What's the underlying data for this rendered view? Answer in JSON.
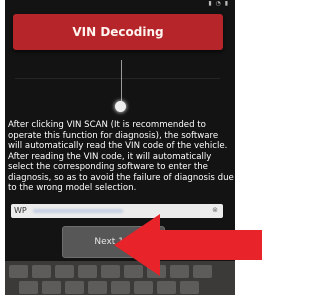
{
  "header": {
    "title": "VIN Decoding"
  },
  "tutorial": {
    "text": "After clicking VIN SCAN (It is recommended to operate this function for diagnosis), the software will automatically read the VIN code of the vehicle. After reading the VIN code, it will automatically select the corresponding software to enter the diagnosis, so as to avoid the failure of diagnosis due to the wrong model selection."
  },
  "vin_input": {
    "value_prefix": "WP"
  },
  "next_button": {
    "label": "Next 1/3"
  },
  "colors": {
    "header": "#b5252a",
    "arrow": "#e8232a",
    "overlay": "#131313"
  },
  "icons": [
    "clear-icon",
    "pointer-dot",
    "red-arrow-icon"
  ]
}
